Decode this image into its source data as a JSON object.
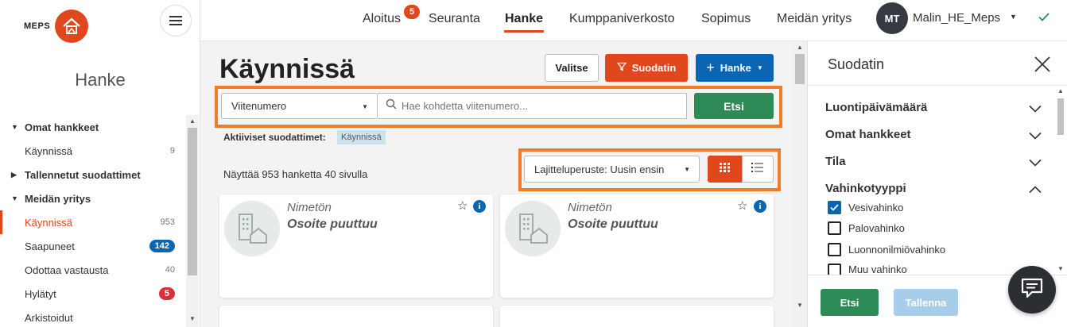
{
  "brand": {
    "logo_text": "MEPS"
  },
  "sidebar": {
    "title": "Hanke",
    "items": [
      {
        "type": "group",
        "label": "Omat hankkeet",
        "expanded": true
      },
      {
        "type": "sub",
        "label": "Käynnissä",
        "count": "9"
      },
      {
        "type": "group",
        "label": "Tallennetut suodattimet",
        "expanded": false
      },
      {
        "type": "group",
        "label": "Meidän yritys",
        "expanded": true
      },
      {
        "type": "sub",
        "label": "Käynnissä",
        "count": "953",
        "active": true
      },
      {
        "type": "sub",
        "label": "Saapuneet",
        "count": "142",
        "badge": "blue"
      },
      {
        "type": "sub",
        "label": "Odottaa vastausta",
        "count": "40"
      },
      {
        "type": "sub",
        "label": "Hylätyt",
        "count": "5",
        "badge": "red"
      },
      {
        "type": "sub",
        "label": "Arkistoidut"
      }
    ]
  },
  "topnav": {
    "items": [
      "Aloitus",
      "Seuranta",
      "Hanke",
      "Kumppaniverkosto",
      "Sopimus",
      "Meidän yritys"
    ],
    "active": "Hanke",
    "aloitus_badge": "5",
    "user_initials": "MT",
    "user_name": "Malin_HE_Meps"
  },
  "main": {
    "title": "Käynnissä",
    "buttons": {
      "valitse": "Valitse",
      "suodatin": "Suodatin",
      "hanke": "Hanke"
    },
    "search": {
      "field_select": "Viitenumero",
      "placeholder": "Hae kohdetta viitenumero...",
      "button": "Etsi"
    },
    "active_filters_label": "Aktiiviset suodattimet:",
    "active_filter_chip": "Käynnissä",
    "showing_text": "Näyttää 953 hanketta 40 sivulla",
    "sort_select": "Lajitteluperuste: Uusin ensin",
    "cards": [
      {
        "name": "Nimetön",
        "address": "Osoite puuttuu"
      },
      {
        "name": "Nimetön",
        "address": "Osoite puuttuu"
      }
    ]
  },
  "filter_panel": {
    "title": "Suodatin",
    "sections": [
      "Luontipäivämäärä",
      "Omat hankkeet",
      "Tila",
      "Vahinkotyyppi"
    ],
    "damage_types": [
      {
        "label": "Vesivahinko",
        "checked": true
      },
      {
        "label": "Palovahinko",
        "checked": false
      },
      {
        "label": "Luonnonilmiövahinko",
        "checked": false
      },
      {
        "label": "Muu vahinko",
        "checked": false
      }
    ],
    "buttons": {
      "etsi": "Etsi",
      "tallenna": "Tallenna"
    }
  },
  "colors": {
    "accent_orange": "#e0471d",
    "primary_blue": "#0a66b2",
    "success_green": "#2e8b57",
    "highlight": "#f07c2a"
  }
}
